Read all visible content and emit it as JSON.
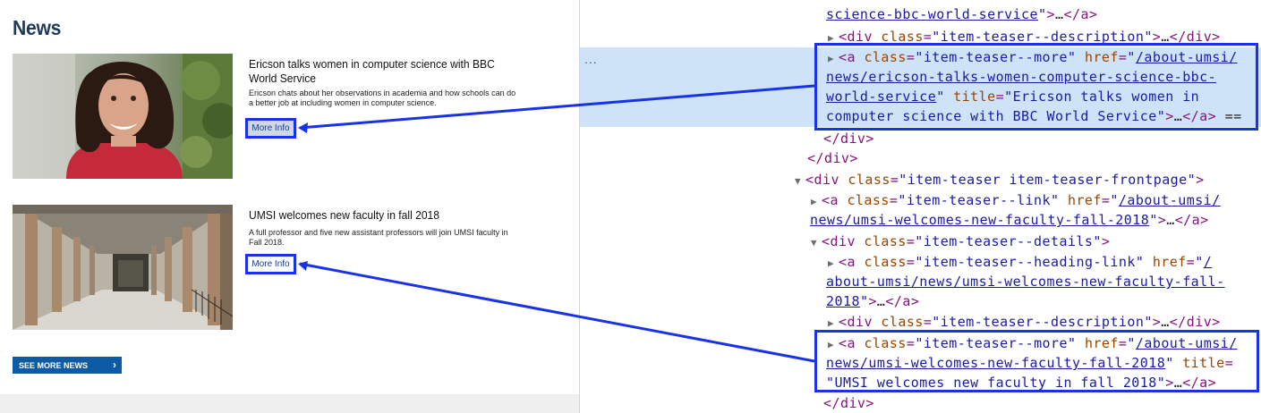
{
  "page": {
    "title": "News",
    "items": [
      {
        "heading": "Ericson talks women in computer science with BBC World Service",
        "description": "Ericson chats about her observations in academia and how schools can do a better job at including women in computer science.",
        "button": "More Info"
      },
      {
        "heading": "UMSI welcomes new faculty in fall 2018",
        "description": "A full professor and five new assistant professors will join UMSI faculty in Fall 2018.",
        "button": "More Info"
      }
    ],
    "see_more": "SEE MORE NEWS",
    "see_more_icon": "chevron-right-icon"
  },
  "devtools": {
    "ellipsis": "...",
    "lines": [
      {
        "t": "science-bbc-world-service\">…</a>"
      },
      {
        "t": "<div class=\"item-teaser--description\">…</div>"
      },
      {
        "t": "<a class=\"item-teaser--more\" href=\"/about-umsi/"
      },
      {
        "t": "news/ericson-talks-women-computer-science-bbc-"
      },
      {
        "t": "world-service\" title=\"Ericson talks women in"
      },
      {
        "t": "computer science with BBC World Service\">…</a> =="
      },
      {
        "t": "</div>"
      },
      {
        "t": "</div>"
      },
      {
        "t": "<div class=\"item-teaser item-teaser-frontpage\">"
      },
      {
        "t": "<a class=\"item-teaser--link\" href=\"/about-umsi/"
      },
      {
        "t": "news/umsi-welcomes-new-faculty-fall-2018\">…</a>"
      },
      {
        "t": "<div class=\"item-teaser--details\">"
      },
      {
        "t": "<a class=\"item-teaser--heading-link\" href=\"/"
      },
      {
        "t": "about-umsi/news/umsi-welcomes-new-faculty-fall-"
      },
      {
        "t": "2018\">…</a>"
      },
      {
        "t": "<div class=\"item-teaser--description\">…</div>"
      },
      {
        "t": "<a class=\"item-teaser--more\" href=\"/about-umsi/"
      },
      {
        "t": "news/umsi-welcomes-new-faculty-fall-2018\" title="
      },
      {
        "t": "\"UMSI welcomes new faculty in fall 2018\">…</a>"
      },
      {
        "t": "</div>"
      }
    ]
  },
  "colors": {
    "highlight_box": "#1a32e6",
    "title": "#1f3b5b",
    "see_more_bg": "#0d5aa7",
    "selected_row": "#cfe3f8"
  }
}
